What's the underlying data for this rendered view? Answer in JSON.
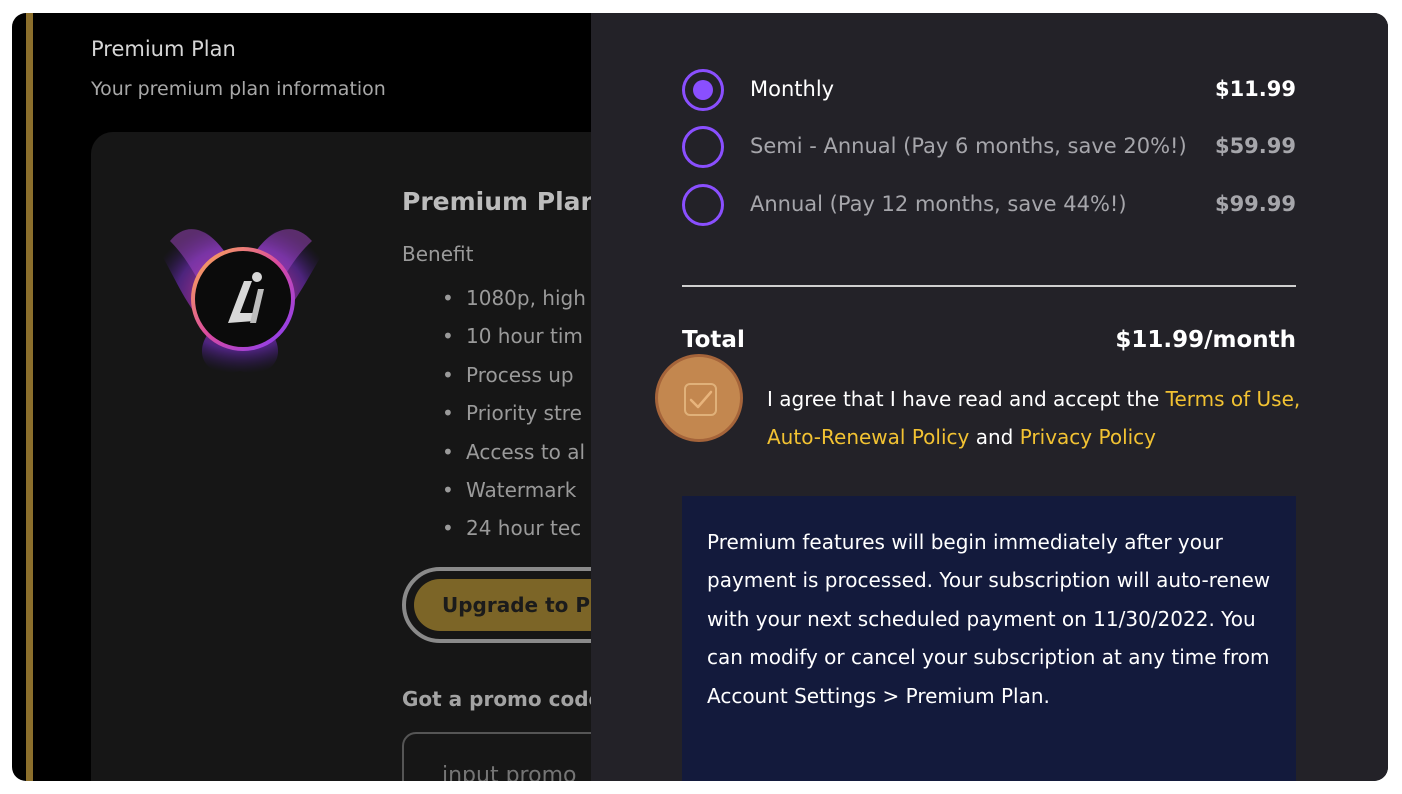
{
  "background_page": {
    "title": "Premium Plan",
    "subtitle": "Your premium plan information",
    "card": {
      "plan_name": "Premium Plan",
      "benefit_label": "Benefit",
      "benefits": [
        "1080p, high",
        "10 hour tim",
        "Process up",
        "Priority stre",
        "Access to al",
        "Watermark",
        "24 hour tec"
      ],
      "upgrade_button": "Upgrade to Pr",
      "promo_label": "Got a promo code",
      "promo_placeholder": "input promo"
    }
  },
  "checkout": {
    "options": [
      {
        "label": "Monthly",
        "price": "$11.99",
        "selected": true
      },
      {
        "label": "Semi - Annual (Pay 6 months, save 20%!)",
        "price": "$59.99",
        "selected": false
      },
      {
        "label": "Annual (Pay 12 months, save 44%!)",
        "price": "$99.99",
        "selected": false
      }
    ],
    "total_label": "Total",
    "total_value": "$11.99/month",
    "agree": {
      "prefix": "I agree that I have read and accept the ",
      "link1": "Terms of Use, Auto-Renewal Policy",
      "middle": " and ",
      "link2": "Privacy Policy",
      "checked": true
    },
    "notice": "Premium features will begin immediately after your payment is processed. Your subscription will auto-renew with your next scheduled payment on 11/30/2022. You can modify or cancel your subscription at any time from Account Settings > Premium Plan."
  },
  "colors": {
    "accent_purple": "#8a4fff",
    "link_gold": "#f2c232",
    "panel_bg": "#232228",
    "notice_bg": "#131a3c",
    "checkbox_highlight": "#c3874f"
  },
  "icons": {
    "logo": "app-logo-icon",
    "check": "check-icon"
  }
}
